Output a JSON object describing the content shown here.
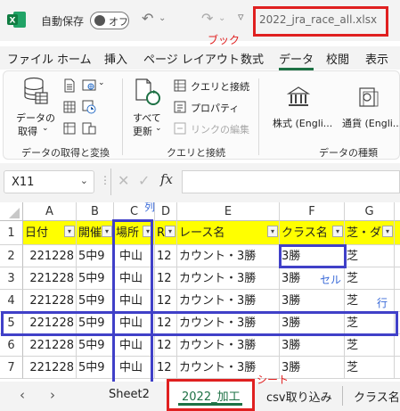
{
  "titlebar": {
    "autosave_label": "自動保存",
    "toggle_text": "オフ",
    "filename": "2022_jra_race_all.xlsx",
    "annotation": "ブック"
  },
  "menu": {
    "items": [
      "ファイル",
      "ホーム",
      "挿入",
      "ページ レイアウト",
      "数式",
      "データ",
      "校閲",
      "表示"
    ],
    "active": "データ"
  },
  "ribbon": {
    "get_data_line1": "データの",
    "get_data_line2": "取得",
    "refresh_line1": "すべて",
    "refresh_line2": "更新",
    "queries_connections": "クエリと接続",
    "properties": "プロパティ",
    "edit_links": "リンクの編集",
    "stocks": "株式 (Engli...",
    "currency": "通貨 (Engli...",
    "group_get_transform": "データの取得と変換",
    "group_queries": "クエリと接続",
    "group_data_types": "データの種類"
  },
  "formula_bar": {
    "namebox": "X11",
    "fx": "fx"
  },
  "grid": {
    "columns": [
      "A",
      "B",
      "C",
      "D",
      "E",
      "F",
      "G"
    ],
    "rows": [
      "1",
      "2",
      "3",
      "4",
      "5",
      "6",
      "7"
    ],
    "header_row": [
      "日付",
      "開催",
      "場所",
      "R",
      "レース名",
      "クラス名",
      "芝・ダ"
    ],
    "data": [
      [
        "221228",
        "5中9",
        "中山",
        "12",
        "カウント・3勝",
        "3勝",
        "芝"
      ],
      [
        "221228",
        "5中9",
        "中山",
        "12",
        "カウント・3勝",
        "3勝",
        "芝"
      ],
      [
        "221228",
        "5中9",
        "中山",
        "12",
        "カウント・3勝",
        "3勝",
        "芝"
      ],
      [
        "221228",
        "5中9",
        "中山",
        "12",
        "カウント・3勝",
        "3勝",
        "芝"
      ],
      [
        "221228",
        "5中9",
        "中山",
        "12",
        "カウント・3勝",
        "3勝",
        "芝"
      ],
      [
        "221228",
        "5中9",
        "中山",
        "12",
        "カウント・3勝",
        "3勝",
        "芝"
      ]
    ],
    "annotations": {
      "column": "列",
      "cell": "セル",
      "row": "行"
    }
  },
  "sheet_tabs": {
    "tabs": [
      "Sheet2",
      "2022_加工",
      "csv取り込み",
      "クラス名"
    ],
    "active": "2022_加工",
    "annotation": "シート"
  },
  "colors": {
    "excel_green": "#1e7145",
    "header_fill": "#ffff00",
    "annotation_red": "#e02020",
    "annotation_blue": "#4040c8"
  }
}
